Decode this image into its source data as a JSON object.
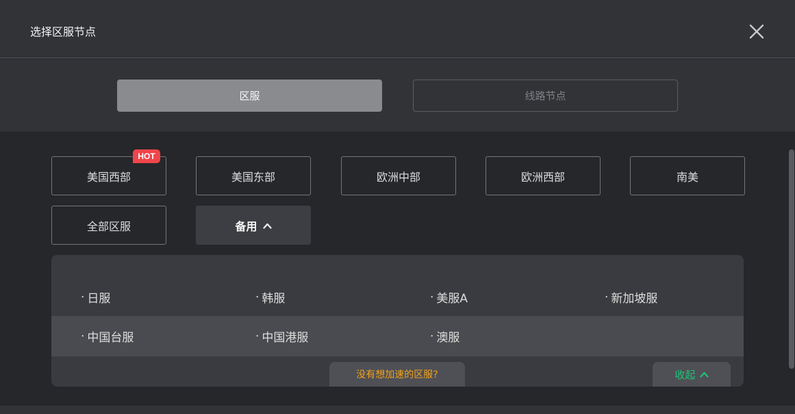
{
  "dialog": {
    "title": "选择区服节点",
    "close_icon": "close-icon"
  },
  "tabs": [
    {
      "label": "区服",
      "active": true
    },
    {
      "label": "线路节点",
      "active": false
    }
  ],
  "regions": {
    "hot_badge": "HOT",
    "items": [
      "美国西部",
      "美国东部",
      "欧洲中部",
      "欧洲西部",
      "南美",
      "全部区服"
    ],
    "backup_label": "备用"
  },
  "backup_panel": {
    "bullet": "·",
    "rows": [
      [
        "日服",
        "韩服",
        "美服A",
        "新加坡服"
      ],
      [
        "中国台服",
        "中国港服",
        "澳服"
      ]
    ],
    "ask_label": "没有想加速的区服?",
    "collapse_label": "收起"
  },
  "colors": {
    "accent_green": "#1fc47a",
    "accent_orange": "#f2a21a",
    "hot_red": "#f0454a"
  }
}
